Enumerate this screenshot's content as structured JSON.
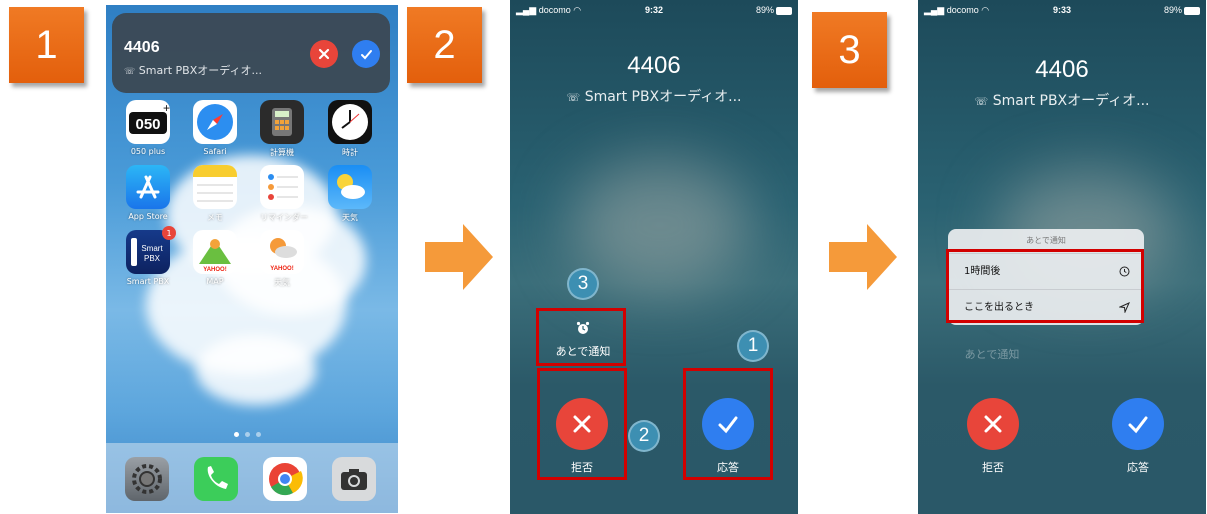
{
  "steps": {
    "one": "1",
    "two": "2",
    "three": "3"
  },
  "notification": {
    "caller_number": "4406",
    "caller_app": "Smart PBXオーディオ...",
    "decline_icon": "close-icon",
    "accept_icon": "check-icon"
  },
  "home_apps": [
    {
      "label": "050 plus",
      "icon": "050plus-icon",
      "badge": ""
    },
    {
      "label": "Safari",
      "icon": "safari-icon",
      "badge": ""
    },
    {
      "label": "計算機",
      "icon": "calculator-icon",
      "badge": ""
    },
    {
      "label": "時計",
      "icon": "clock-icon",
      "badge": ""
    },
    {
      "label": "App Store",
      "icon": "app-store-icon",
      "badge": ""
    },
    {
      "label": "メモ",
      "icon": "notes-icon",
      "badge": ""
    },
    {
      "label": "リマインダー",
      "icon": "reminders-icon",
      "badge": ""
    },
    {
      "label": "天気",
      "icon": "weather-icon",
      "badge": ""
    },
    {
      "label": "Smart PBX",
      "icon": "smart-pbx-icon",
      "badge": "1"
    },
    {
      "label": "MAP",
      "icon": "yahoo-map-icon",
      "badge": ""
    },
    {
      "label": "天気",
      "icon": "yahoo-weather-icon",
      "badge": ""
    }
  ],
  "smart_pbx_icon_text": "Smart PBX",
  "yahoo_text": "YAHOO!",
  "dock": [
    "settings-icon",
    "phone-icon",
    "chrome-icon",
    "camera-icon"
  ],
  "call2": {
    "carrier": "docomo",
    "time": "9:32",
    "battery": "89%",
    "caller_number": "4406",
    "caller_app": "Smart PBXオーディオ...",
    "remind_label": "あとで通知",
    "decline_label": "拒否",
    "accept_label": "応答",
    "badges": {
      "remind": "3",
      "decline": "2",
      "accept": "1"
    }
  },
  "call3": {
    "carrier": "docomo",
    "time": "9:33",
    "battery": "89%",
    "caller_number": "4406",
    "caller_app": "Smart PBXオーディオ...",
    "menu_title": "あとで通知",
    "menu_items": [
      {
        "label": "1時間後",
        "icon": "clock-icon"
      },
      {
        "label": "ここを出るとき",
        "icon": "location-arrow-icon"
      }
    ],
    "remind_label": "あとで通知",
    "decline_label": "拒否",
    "accept_label": "応答"
  },
  "colors": {
    "badge_orange": "#e8661a",
    "decline_red": "#e8453a",
    "accept_blue": "#2f7ef0",
    "highlight_red": "#d20000",
    "arrow_orange": "#f59a3a"
  }
}
